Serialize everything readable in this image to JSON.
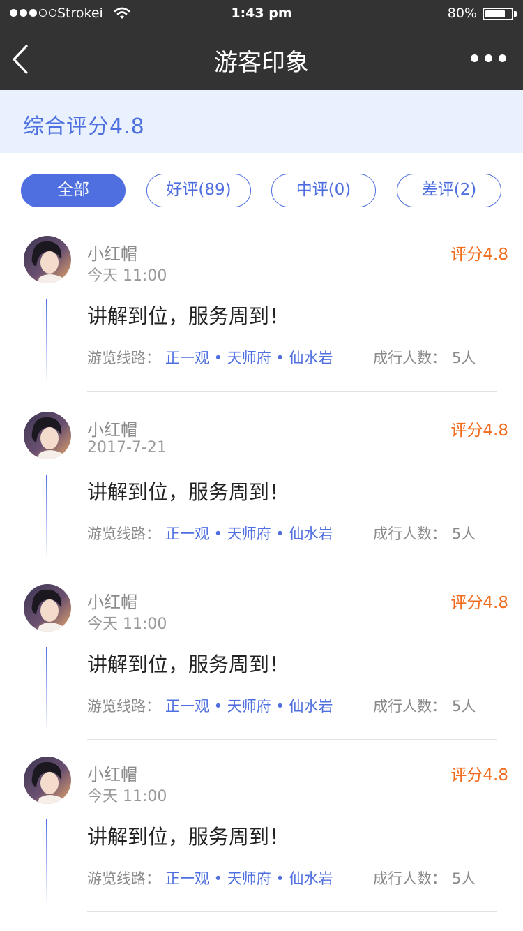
{
  "status_bar": {
    "carrier": "Strokei",
    "time": "1:43 pm",
    "battery_percent_text": "80%",
    "battery_level": 0.8
  },
  "nav": {
    "title": "游客印象",
    "back_icon": "chevron-left-icon",
    "more_icon": "more-horizontal-icon"
  },
  "summary": {
    "score_text": "综合评分4.8"
  },
  "tabs": [
    {
      "label": "全部",
      "active": true
    },
    {
      "label": "好评(89)",
      "active": false
    },
    {
      "label": "中评(0)",
      "active": false
    },
    {
      "label": "差评(2)",
      "active": false
    }
  ],
  "reviews": [
    {
      "user": "小红帽",
      "date": "今天 11:00",
      "rating": "评分4.8",
      "comment": "讲解到位，服务周到！",
      "route_label": "游览线路：",
      "route": "正一观 • 天师府 • 仙水岩",
      "people_label": "成行人数：",
      "people": "5人"
    },
    {
      "user": "小红帽",
      "date": "2017-7-21",
      "rating": "评分4.8",
      "comment": "讲解到位，服务周到！",
      "route_label": "游览线路：",
      "route": "正一观 • 天师府 • 仙水岩",
      "people_label": "成行人数：",
      "people": "5人"
    },
    {
      "user": "小红帽",
      "date": "今天 11:00",
      "rating": "评分4.8",
      "comment": "讲解到位，服务周到！",
      "route_label": "游览线路：",
      "route": "正一观 • 天师府 • 仙水岩",
      "people_label": "成行人数：",
      "people": "5人"
    },
    {
      "user": "小红帽",
      "date": "今天 11:00",
      "rating": "评分4.8",
      "comment": "讲解到位，服务周到！",
      "route_label": "游览线路：",
      "route": "正一观 • 天师府 • 仙水岩",
      "people_label": "成行人数：",
      "people": "5人"
    }
  ],
  "colors": {
    "accent": "#4f6fe0",
    "rating": "#f26b1d",
    "header_bg": "#333333",
    "summary_bg": "#e9f0fe"
  }
}
